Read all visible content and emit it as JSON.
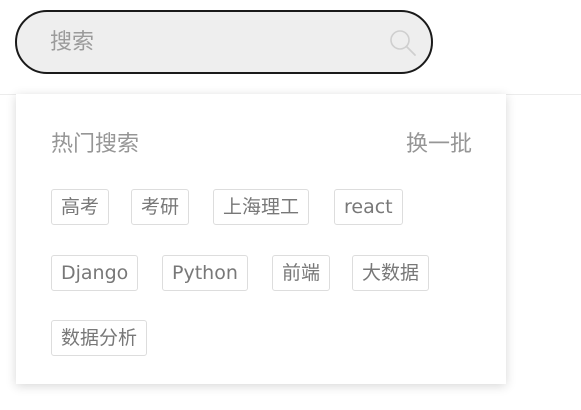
{
  "search": {
    "placeholder": "搜索",
    "value": ""
  },
  "hot": {
    "title": "热门搜索",
    "refresh_label": "换一批",
    "tags": [
      "高考",
      "考研",
      "上海理工",
      "react",
      "Django",
      "Python",
      "前端",
      "大数据",
      "数据分析"
    ]
  },
  "colors": {
    "search_bg": "#eeeeee",
    "search_border": "#1a1a1a",
    "muted_text": "#969696",
    "tag_border": "#dddddd"
  },
  "icons": {
    "search": "search-icon"
  }
}
